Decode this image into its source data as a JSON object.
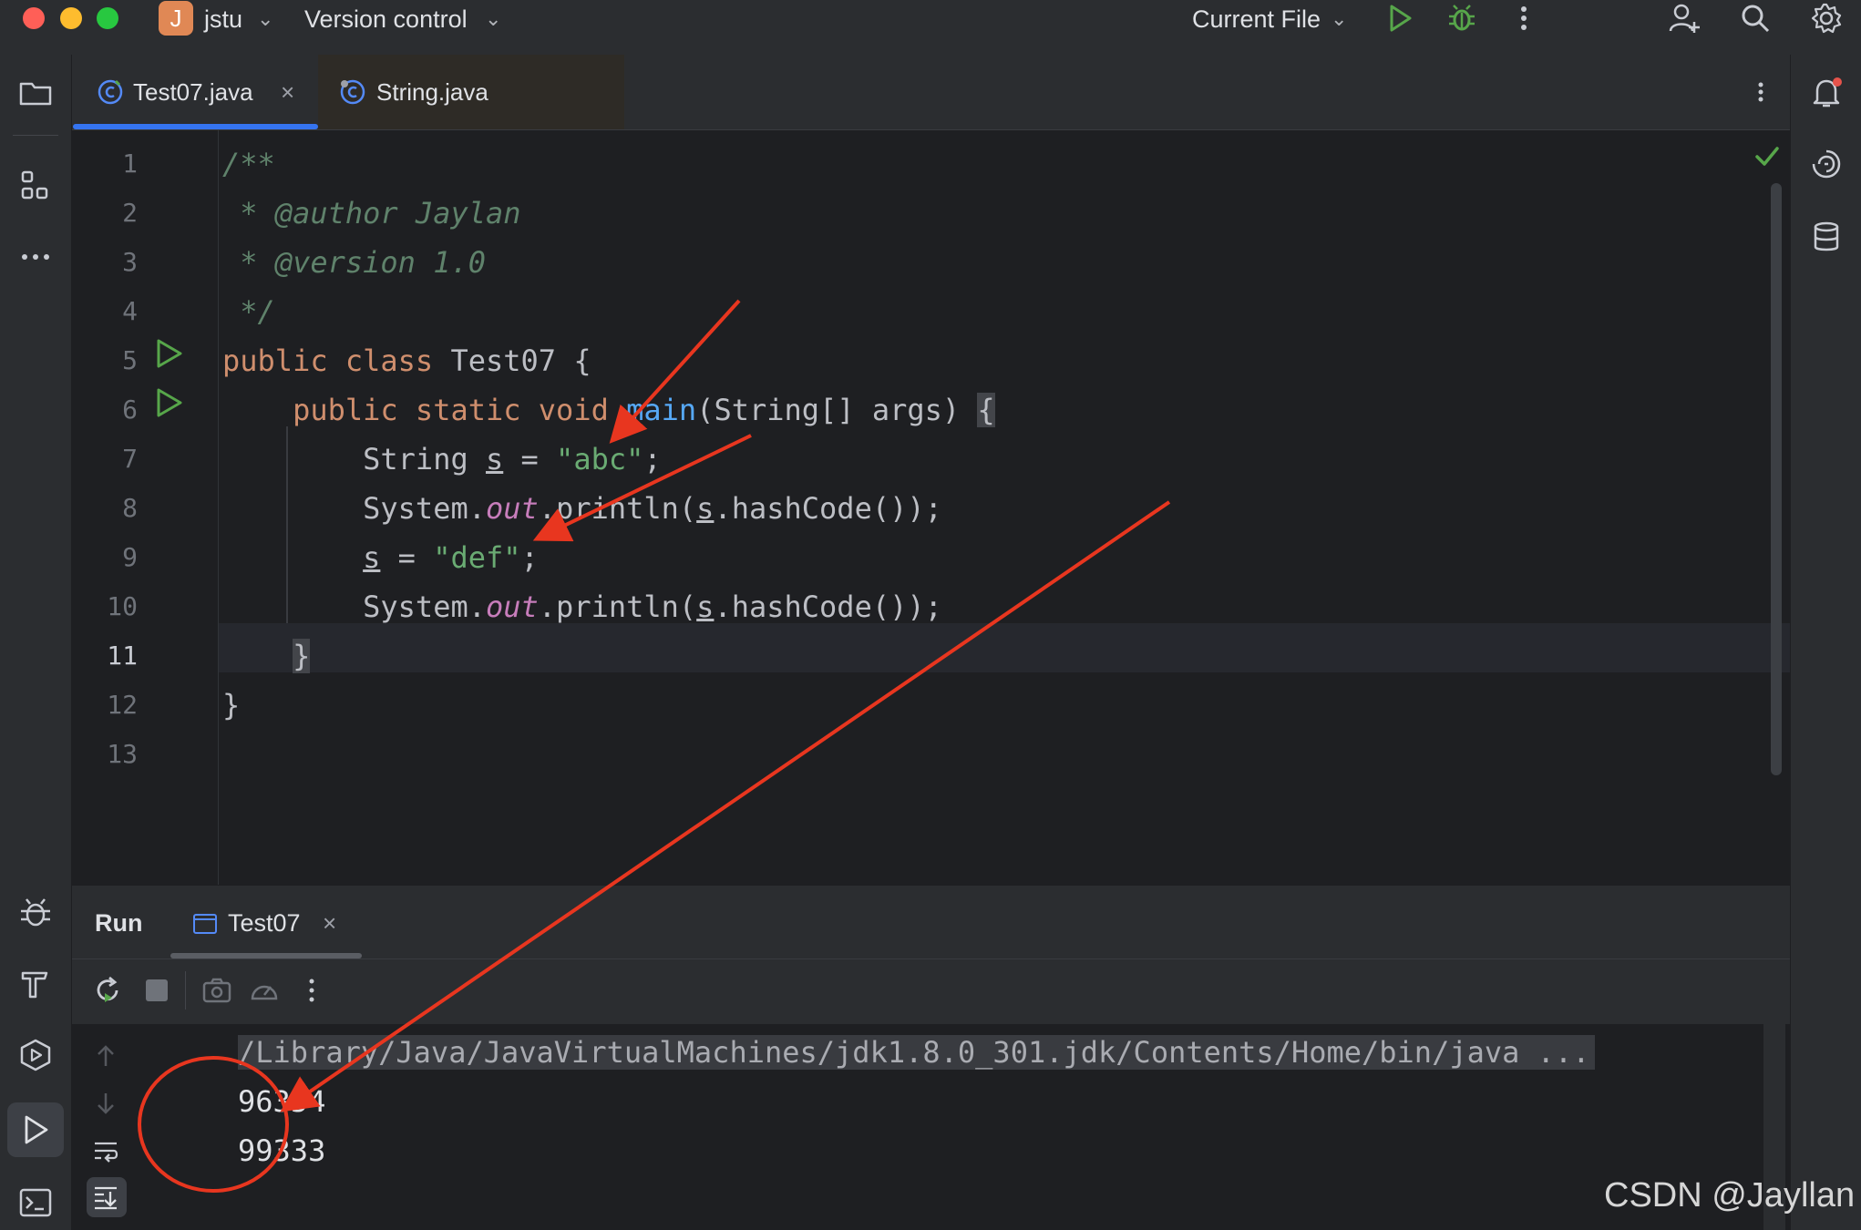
{
  "titlebar": {
    "project_initial": "J",
    "project_name": "jstu",
    "vcs_label": "Version control",
    "run_config": "Current File"
  },
  "tabs": [
    {
      "label": "Test07.java",
      "close": "×"
    },
    {
      "label": "String.java"
    }
  ],
  "editor": {
    "line_numbers": [
      "1",
      "2",
      "3",
      "4",
      "5",
      "6",
      "7",
      "8",
      "9",
      "10",
      "11",
      "12",
      "13"
    ]
  },
  "run_panel": {
    "title": "Run",
    "tab_label": "Test07",
    "tab_close": "×",
    "console": [
      "/Library/Java/JavaVirtualMachines/jdk1.8.0_301.jdk/Contents/Home/bin/java ...",
      "96354",
      "99333"
    ]
  },
  "watermark": "CSDN @Jayllan",
  "colors": {
    "accent": "#3574f0",
    "keyword": "#cf8e6d",
    "string": "#6aab73",
    "comment": "#5f826b",
    "annotation_red": "#e8361f"
  },
  "icons": [
    "folder-icon",
    "structure-icon",
    "more-icon",
    "debug-icon",
    "build-icon",
    "services-icon",
    "run-icon",
    "terminal-icon",
    "notifications-icon",
    "ai-assistant-icon",
    "database-icon",
    "run-button-icon",
    "debug-button-icon",
    "add-user-icon",
    "search-icon",
    "settings-icon"
  ]
}
